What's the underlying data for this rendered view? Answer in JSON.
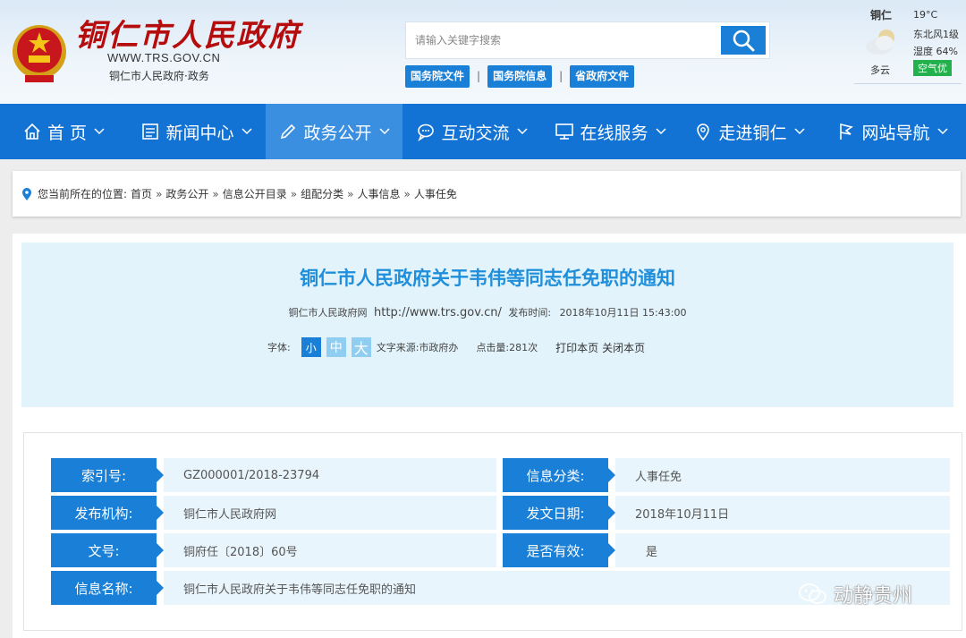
{
  "header": {
    "site_title": "铜仁市人民政府",
    "site_url": "WWW.TRS.GOV.CN",
    "site_subtitle": "铜仁市人民政府·政务",
    "search_placeholder": "请输入关键字搜索",
    "quick_links": [
      "国务院文件",
      "国务院信息",
      "省政府文件"
    ],
    "quick_sep": "|"
  },
  "weather": {
    "city": "铜仁",
    "temperature": "19°C",
    "wind": "东北风1级",
    "humidity": "湿度 64%",
    "condition": "多云",
    "air_quality": "空气优"
  },
  "nav": [
    {
      "label": "首 页",
      "icon": "home-icon"
    },
    {
      "label": "新闻中心",
      "icon": "news-icon"
    },
    {
      "label": "政务公开",
      "icon": "pen-icon"
    },
    {
      "label": "互动交流",
      "icon": "chat-icon"
    },
    {
      "label": "在线服务",
      "icon": "monitor-icon"
    },
    {
      "label": "走进铜仁",
      "icon": "location-icon"
    },
    {
      "label": "网站导航",
      "icon": "flag-icon"
    }
  ],
  "breadcrumb": {
    "prefix": "您当前所在的位置:",
    "items": [
      "首页",
      "政务公开",
      "信息公开目录",
      "组配分类",
      "人事信息",
      "人事任免"
    ],
    "sep": "»"
  },
  "article": {
    "title": "铜仁市人民政府关于韦伟等同志任免职的通知",
    "source_site": "铜仁市人民政府网",
    "source_url": "http://www.trs.gov.cn/",
    "publish_label": "发布时间:",
    "publish_time": "2018年10月11日 15:43:00",
    "font_label": "字体:",
    "font_small": "小",
    "font_medium": "中",
    "font_large": "大",
    "text_source": "文字来源:市政府办",
    "hits": "点击量:281次",
    "print": "打印本页",
    "close": "关闭本页"
  },
  "info": {
    "index_label": "索引号:",
    "index_value": "GZ000001/2018-23794",
    "category_label": "信息分类:",
    "category_value": "人事任免",
    "publisher_label": "发布机构:",
    "publisher_value": "铜仁市人民政府网",
    "date_label": "发文日期:",
    "date_value": "2018年10月11日",
    "docno_label": "文号:",
    "docno_value": "铜府任〔2018〕60号",
    "valid_label": "是否有效:",
    "valid_value": "是",
    "name_label": "信息名称:",
    "name_value": "铜仁市人民政府关于韦伟等同志任免职的通知"
  },
  "watermark": "动静贵州",
  "colors": {
    "nav_blue": "#1273d4",
    "title_blue": "#1f8edb",
    "site_red": "#b50d0d",
    "aq_green": "#22b14c"
  }
}
